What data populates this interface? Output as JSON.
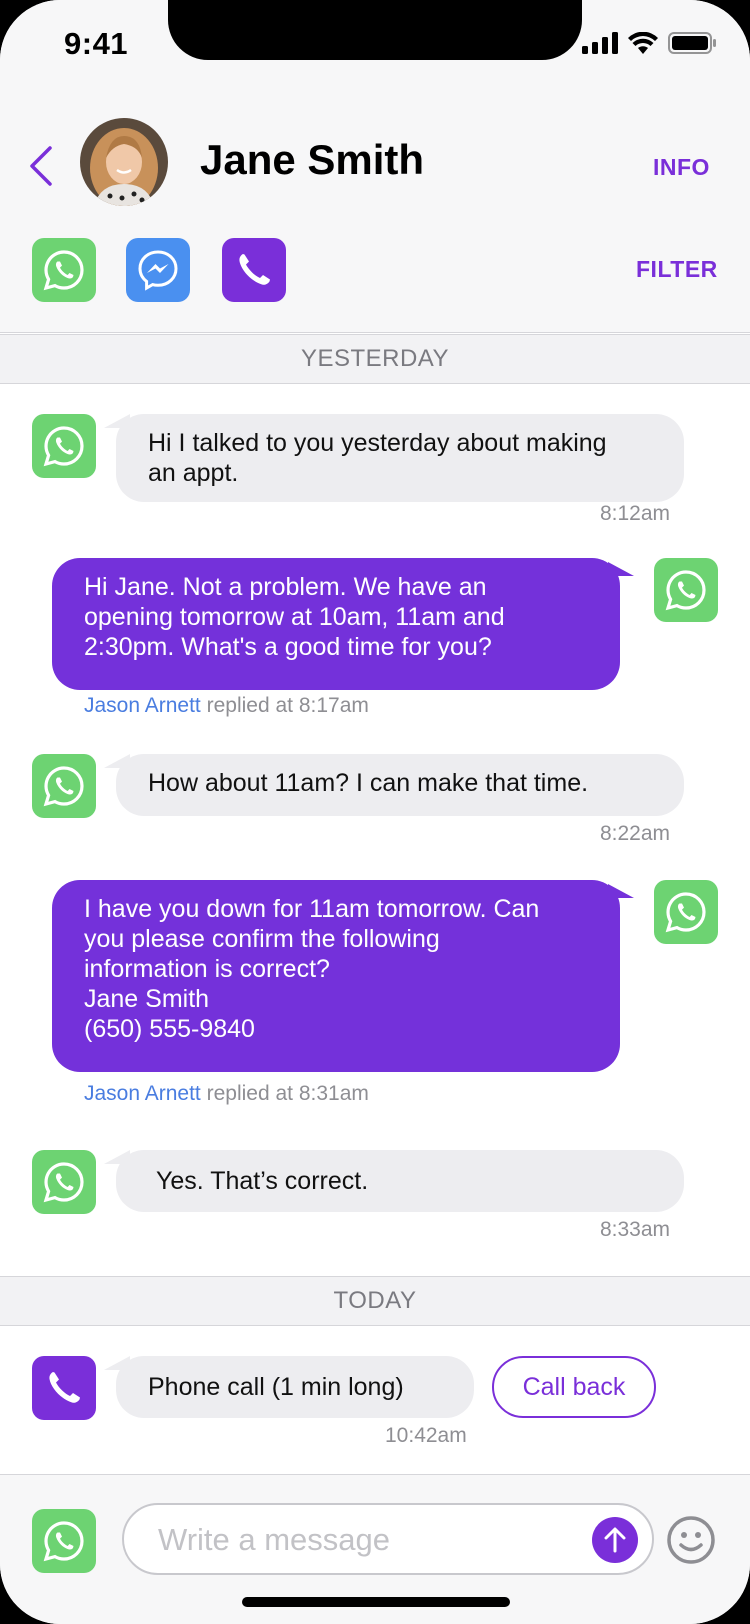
{
  "status_bar": {
    "time": "9:41"
  },
  "header": {
    "contact_name": "Jane Smith",
    "info_label": "INFO",
    "filter_label": "FILTER",
    "channels": [
      "whatsapp-icon",
      "messenger-icon",
      "phone-icon"
    ]
  },
  "colors": {
    "accent": "#7a2fd9",
    "whatsapp": "#6dd372",
    "messenger": "#4a90f0",
    "incoming_bubble": "#ededf0"
  },
  "sections": {
    "yesterday": "YESTERDAY",
    "today": "TODAY"
  },
  "messages": [
    {
      "direction": "in",
      "channel": "whatsapp",
      "lines": [
        "Hi I talked to you yesterday about making",
        "an appt."
      ],
      "time": "8:12am"
    },
    {
      "direction": "out",
      "channel": "whatsapp",
      "lines": [
        "Hi Jane. Not a problem. We have an",
        "opening tomorrow at 10am, 11am and",
        "2:30pm. What's a good time for you?"
      ],
      "agent": "Jason Arnett",
      "reply_text": "replied at 8:17am"
    },
    {
      "direction": "in",
      "channel": "whatsapp",
      "lines": [
        "How about 11am? I can make that time."
      ],
      "time": "8:22am"
    },
    {
      "direction": "out",
      "channel": "whatsapp",
      "lines": [
        "I have you down for 11am tomorrow. Can",
        "you please confirm the following",
        "information is correct?",
        "Jane Smith",
        "(650) 555-9840"
      ],
      "agent": "Jason Arnett",
      "reply_text": "replied at 8:31am"
    },
    {
      "direction": "in",
      "channel": "whatsapp",
      "lines": [
        "Yes. That’s correct."
      ],
      "time": "8:33am"
    }
  ],
  "call": {
    "channel": "phone",
    "text": "Phone call (1 min long)",
    "time": "10:42am",
    "callback_label": "Call back"
  },
  "composer": {
    "placeholder": "Write a message"
  }
}
